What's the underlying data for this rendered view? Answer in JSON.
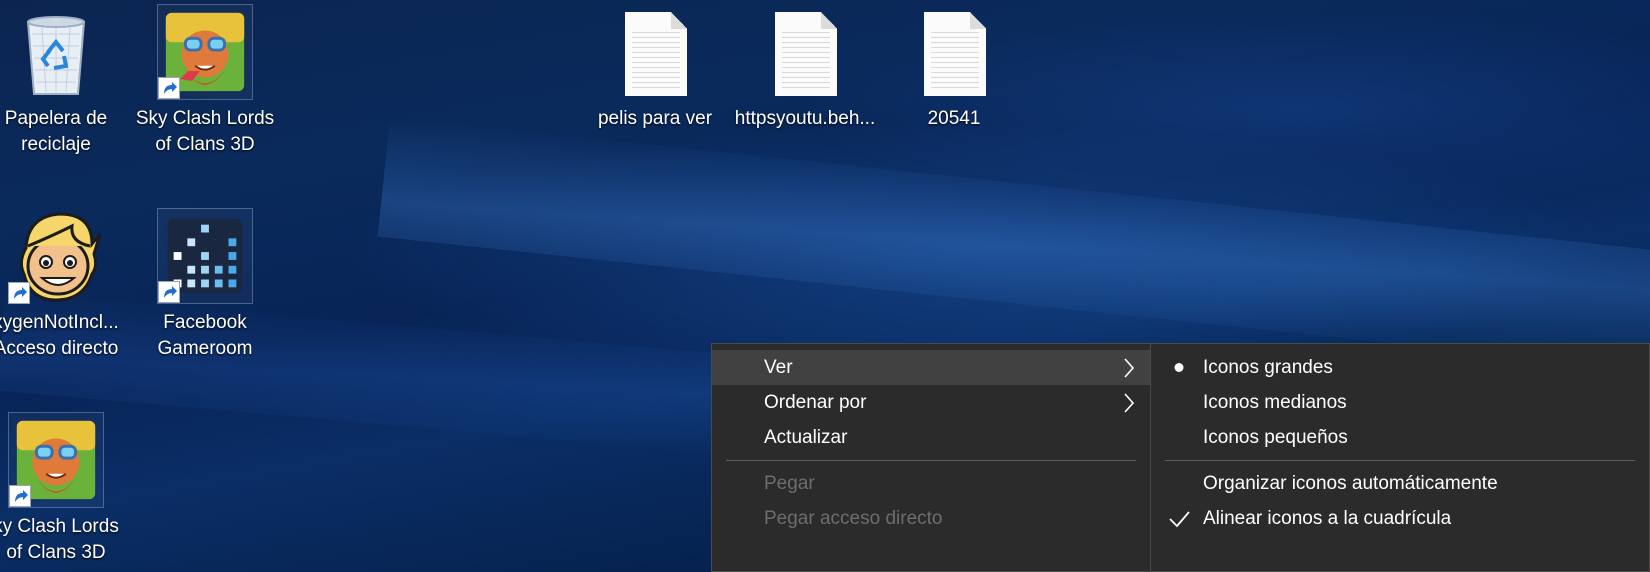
{
  "desktop": {
    "icons": [
      {
        "label_line1": "Papelera de",
        "label_line2": "reciclaje",
        "icon": "recycle-bin-icon"
      },
      {
        "label_line1": "Sky Clash Lords",
        "label_line2": "of Clans 3D",
        "icon": "game-icon"
      },
      {
        "label_line1": "pelis para ver",
        "label_line2": "",
        "icon": "text-file-icon"
      },
      {
        "label_line1": "httpsyoutu.beh...",
        "label_line2": "",
        "icon": "text-file-icon"
      },
      {
        "label_line1": "20541",
        "label_line2": "",
        "icon": "text-file-icon"
      },
      {
        "label_line1": "xygenNotIncl...",
        "label_line2": "Acceso directo",
        "icon": "oxygen-not-included-icon"
      },
      {
        "label_line1": "Facebook",
        "label_line2": "Gameroom",
        "icon": "facebook-gameroom-icon"
      },
      {
        "label_line1": "ky Clash Lords",
        "label_line2": "of Clans 3D",
        "icon": "game-icon"
      }
    ]
  },
  "context_menu": {
    "items": [
      {
        "label": "Ver",
        "has_submenu": true,
        "disabled": false,
        "highlighted": true
      },
      {
        "label": "Ordenar por",
        "has_submenu": true,
        "disabled": false,
        "highlighted": false
      },
      {
        "label": "Actualizar",
        "has_submenu": false,
        "disabled": false,
        "highlighted": false
      },
      {
        "label": "Pegar",
        "has_submenu": false,
        "disabled": true,
        "highlighted": false
      },
      {
        "label": "Pegar acceso directo",
        "has_submenu": false,
        "disabled": true,
        "highlighted": false
      }
    ]
  },
  "submenu_ver": {
    "items": [
      {
        "label": "Iconos grandes",
        "mark": "bullet"
      },
      {
        "label": "Iconos medianos",
        "mark": ""
      },
      {
        "label": "Iconos pequeños",
        "mark": ""
      },
      {
        "label": "Organizar iconos automáticamente",
        "mark": ""
      },
      {
        "label": "Alinear iconos a la cuadrícula",
        "mark": "check"
      }
    ]
  },
  "colors": {
    "menu_bg": "#2b2b2b",
    "menu_highlight": "#414141",
    "menu_disabled_text": "#6d6d6d",
    "desktop_bg": "#0a2a5c"
  }
}
